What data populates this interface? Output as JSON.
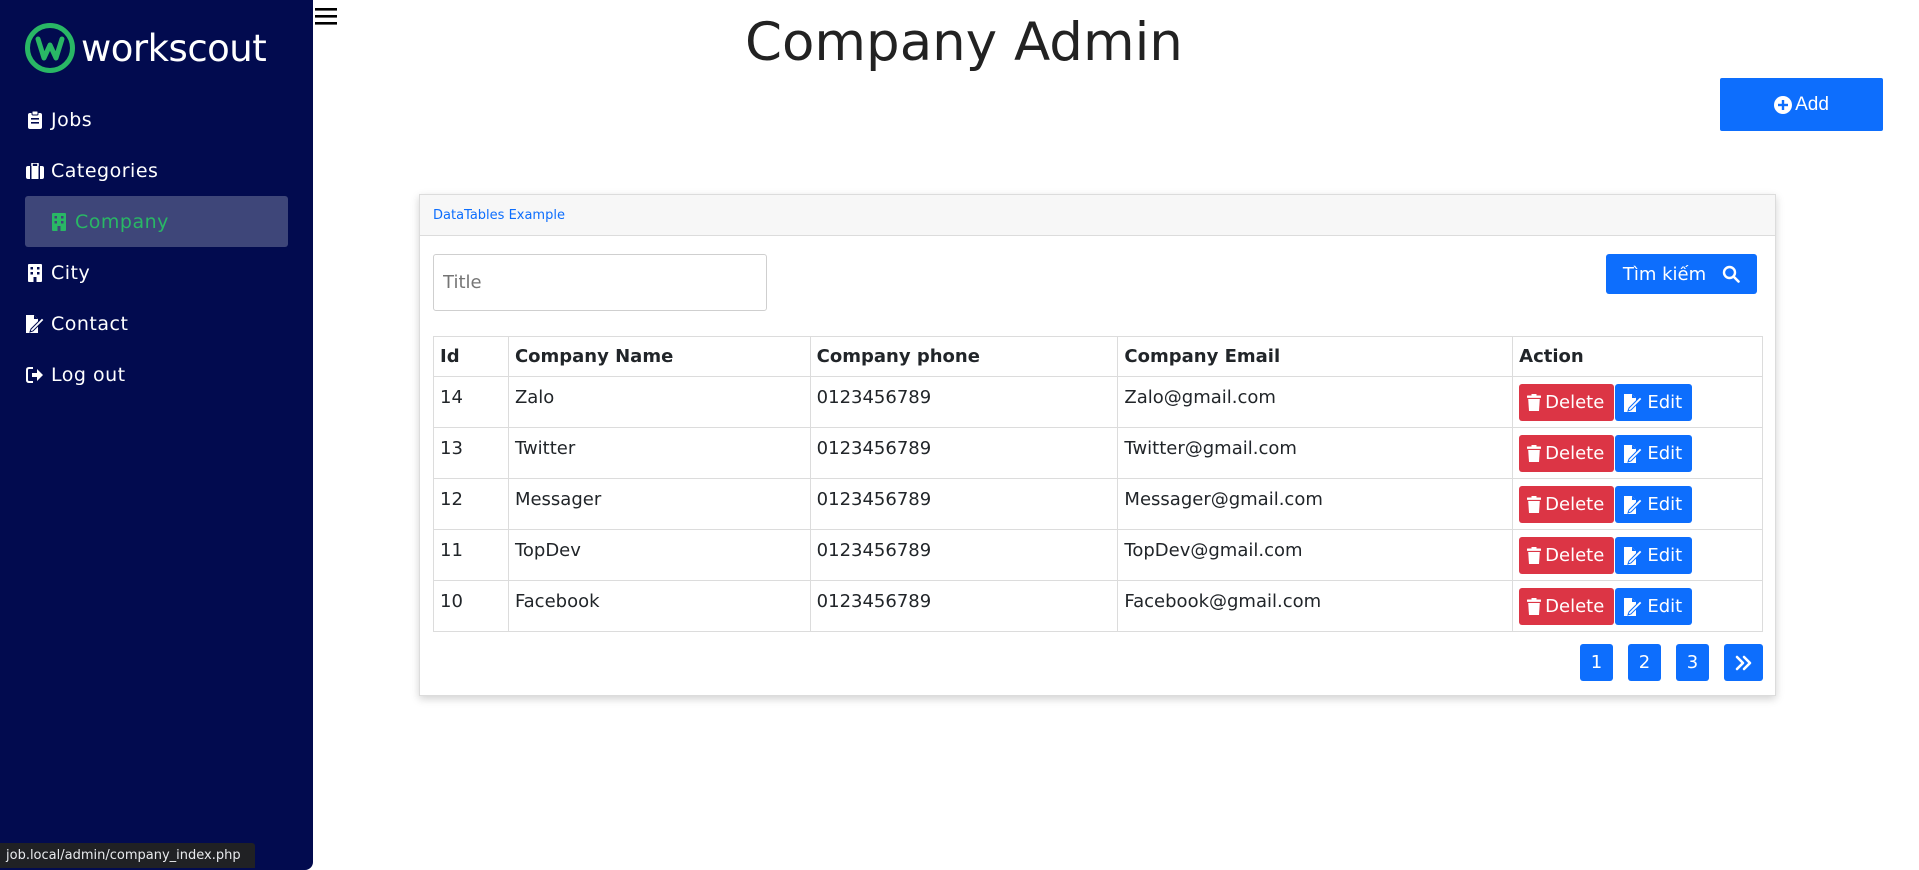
{
  "brand": {
    "name": "workscout",
    "accent": "#29b765"
  },
  "sidebar": {
    "items": [
      {
        "label": "Jobs",
        "icon": "clipboard-icon",
        "active": false
      },
      {
        "label": "Categories",
        "icon": "briefcase-icon",
        "active": false
      },
      {
        "label": "Company",
        "icon": "building-icon",
        "active": true
      },
      {
        "label": "City",
        "icon": "building-icon",
        "active": false
      },
      {
        "label": "Contact",
        "icon": "file-signature-icon",
        "active": false
      },
      {
        "label": "Log out",
        "icon": "sign-out-icon",
        "active": false
      }
    ]
  },
  "header": {
    "title": "Company Admin",
    "add_label": "Add"
  },
  "card": {
    "title": "DataTables Example",
    "search_placeholder": "Title",
    "search_label": "Tìm kiếm",
    "columns": [
      "Id",
      "Company Name",
      "Company phone",
      "Company Email",
      "Action"
    ],
    "rows": [
      {
        "id": "14",
        "name": "Zalo",
        "phone": "0123456789",
        "email": "Zalo@gmail.com"
      },
      {
        "id": "13",
        "name": "Twitter",
        "phone": "0123456789",
        "email": "Twitter@gmail.com"
      },
      {
        "id": "12",
        "name": "Messager",
        "phone": "0123456789",
        "email": "Messager@gmail.com"
      },
      {
        "id": "11",
        "name": "TopDev",
        "phone": "0123456789",
        "email": "TopDev@gmail.com"
      },
      {
        "id": "10",
        "name": "Facebook",
        "phone": "0123456789",
        "email": "Facebook@gmail.com"
      }
    ],
    "delete_label": "Delete",
    "edit_label": "Edit",
    "pages": [
      "1",
      "2",
      "3"
    ],
    "next_icon": "double-chevron-right-icon"
  },
  "statusbar": {
    "url": "job.local/admin/company_index.php"
  },
  "colors": {
    "sidebar_bg": "#020b4f",
    "primary": "#0d6efd",
    "danger": "#dc3545"
  }
}
